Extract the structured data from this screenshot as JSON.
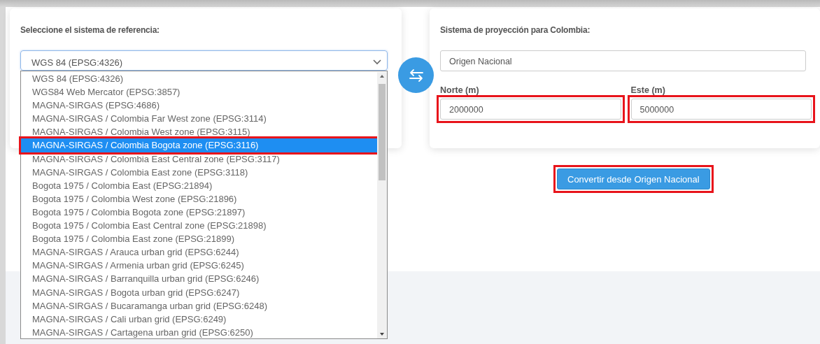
{
  "reference": {
    "label": "Seleccione el sistema de referencia:",
    "select_value": "WGS 84 (EPSG:4326)",
    "options": [
      {
        "label": "WGS 84 (EPSG:4326)",
        "selected": false,
        "highlighted": false
      },
      {
        "label": "WGS84 Web Mercator (EPSG:3857)",
        "selected": false,
        "highlighted": false
      },
      {
        "label": "MAGNA-SIRGAS (EPSG:4686)",
        "selected": false,
        "highlighted": false
      },
      {
        "label": "MAGNA-SIRGAS / Colombia Far West zone (EPSG:3114)",
        "selected": false,
        "highlighted": false
      },
      {
        "label": "MAGNA-SIRGAS / Colombia West zone (EPSG:3115)",
        "selected": false,
        "highlighted": false
      },
      {
        "label": "MAGNA-SIRGAS / Colombia Bogota zone (EPSG:3116)",
        "selected": true,
        "highlighted": true
      },
      {
        "label": "MAGNA-SIRGAS / Colombia East Central zone (EPSG:3117)",
        "selected": false,
        "highlighted": false
      },
      {
        "label": "MAGNA-SIRGAS / Colombia East zone (EPSG:3118)",
        "selected": false,
        "highlighted": false
      },
      {
        "label": "Bogota 1975 / Colombia East (EPSG:21894)",
        "selected": false,
        "highlighted": false
      },
      {
        "label": "Bogota 1975 / Colombia West zone (EPSG:21896)",
        "selected": false,
        "highlighted": false
      },
      {
        "label": "Bogota 1975 / Colombia Bogota zone (EPSG:21897)",
        "selected": false,
        "highlighted": false
      },
      {
        "label": "Bogota 1975 / Colombia East Central zone (EPSG:21898)",
        "selected": false,
        "highlighted": false
      },
      {
        "label": "Bogota 1975 / Colombia East zone (EPSG:21899)",
        "selected": false,
        "highlighted": false
      },
      {
        "label": "MAGNA-SIRGAS / Arauca urban grid (EPSG:6244)",
        "selected": false,
        "highlighted": false
      },
      {
        "label": "MAGNA-SIRGAS / Armenia urban grid (EPSG:6245)",
        "selected": false,
        "highlighted": false
      },
      {
        "label": "MAGNA-SIRGAS / Barranquilla urban grid (EPSG:6246)",
        "selected": false,
        "highlighted": false
      },
      {
        "label": "MAGNA-SIRGAS / Bogota urban grid (EPSG:6247)",
        "selected": false,
        "highlighted": false
      },
      {
        "label": "MAGNA-SIRGAS / Bucaramanga urban grid (EPSG:6248)",
        "selected": false,
        "highlighted": false
      },
      {
        "label": "MAGNA-SIRGAS / Cali urban grid (EPSG:6249)",
        "selected": false,
        "highlighted": false
      },
      {
        "label": "MAGNA-SIRGAS / Cartagena urban grid (EPSG:6250)",
        "selected": false,
        "highlighted": false
      }
    ]
  },
  "projection": {
    "label": "Sistema de proyección para Colombia:",
    "system_value": "Origen Nacional",
    "fields": [
      {
        "label": "Norte (m)",
        "value": "2000000",
        "highlighted": true
      },
      {
        "label": "Este (m)",
        "value": "5000000",
        "highlighted": true
      }
    ]
  },
  "convert_button": {
    "label": "Convertir desde Origen Nacional",
    "highlighted": true
  }
}
